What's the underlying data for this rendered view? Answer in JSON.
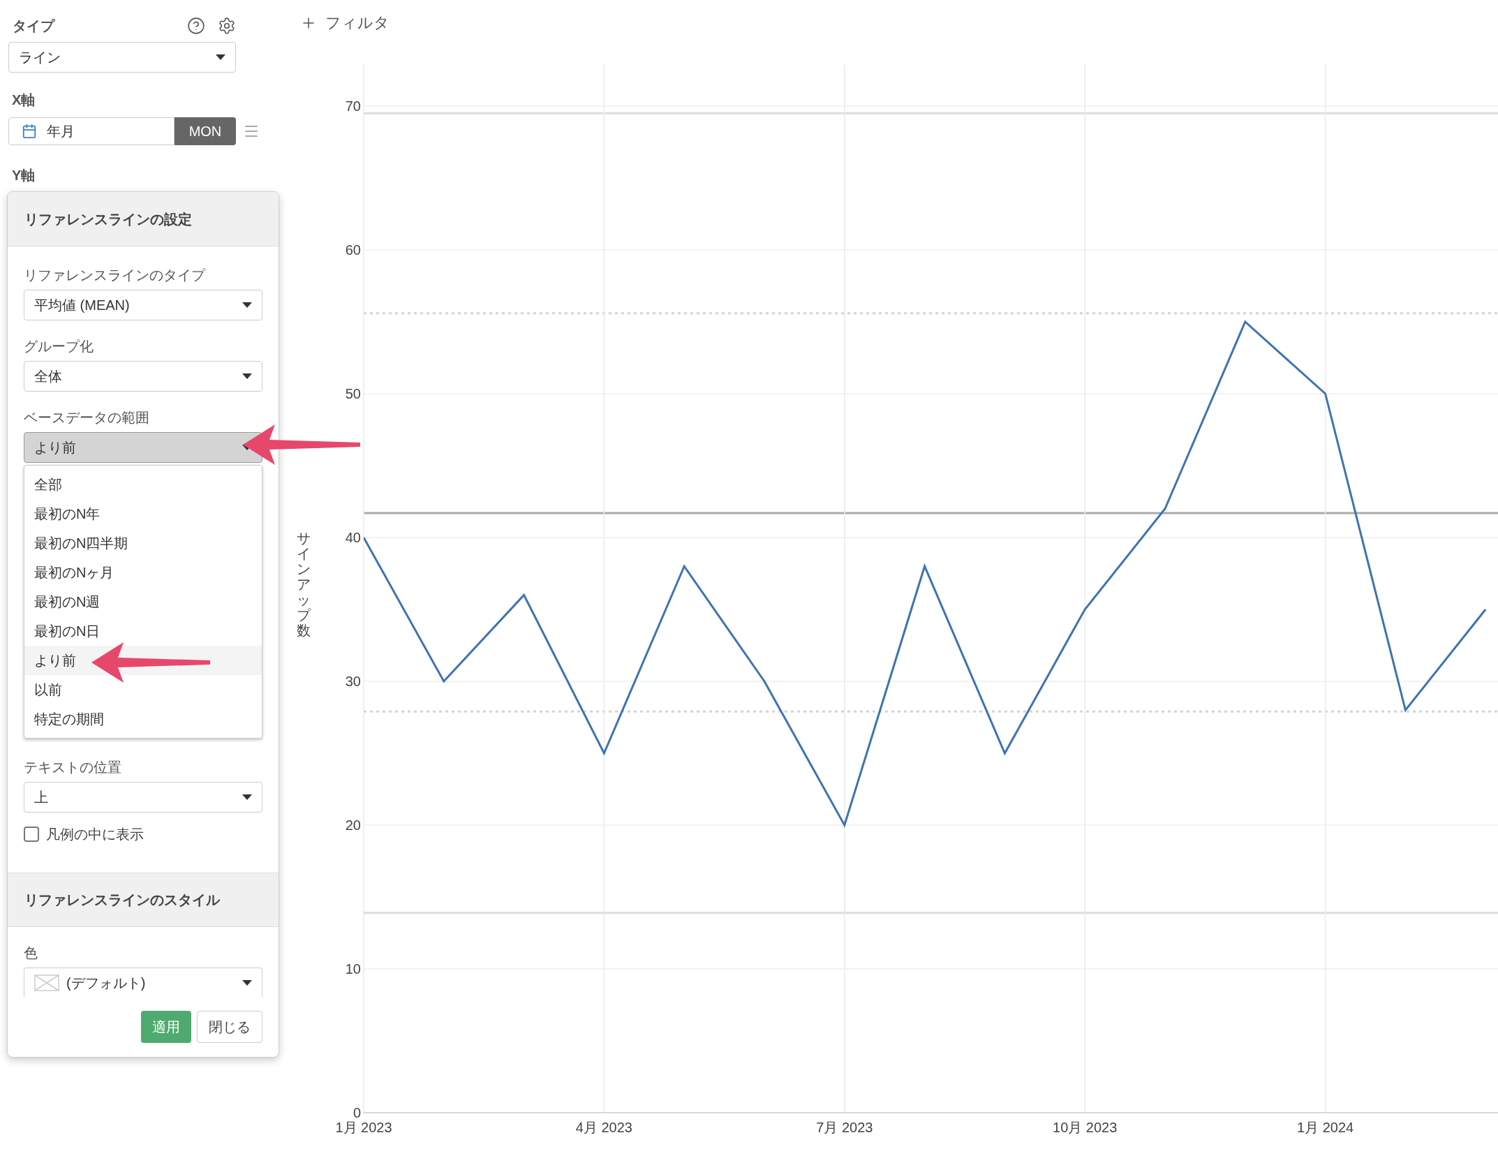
{
  "sidebar": {
    "type_label": "タイプ",
    "type_select": "ライン",
    "x_axis_label": "X軸",
    "x_field": {
      "label": "年月",
      "aggregation": "MON"
    },
    "y_axis_label": "Y軸"
  },
  "filter_button": "フィルタ",
  "reference_panel": {
    "title": "リファレンスラインの設定",
    "fields": [
      {
        "label": "リファレンスラインのタイプ",
        "value": "平均値 (MEAN)"
      },
      {
        "label": "グループ化",
        "value": "全体"
      }
    ],
    "range": {
      "label": "ベースデータの範囲",
      "value": "より前",
      "open": true,
      "options": [
        {
          "label": "全部",
          "selected": false
        },
        {
          "label": "最初のN年",
          "selected": false
        },
        {
          "label": "最初のN四半期",
          "selected": false
        },
        {
          "label": "最初のNヶ月",
          "selected": false
        },
        {
          "label": "最初のN週",
          "selected": false
        },
        {
          "label": "最初のN日",
          "selected": false
        },
        {
          "label": "より前",
          "selected": true
        },
        {
          "label": "以前",
          "selected": false
        },
        {
          "label": "特定の期間",
          "selected": false
        }
      ]
    },
    "text_position": {
      "label": "テキストの位置",
      "value": "上"
    },
    "legend_checkbox": {
      "label": "凡例の中に表示",
      "checked": false
    },
    "style_title": "リファレンスラインのスタイル",
    "color": {
      "label": "色",
      "value": "(デフォルト)"
    },
    "buttons": [
      {
        "label": "適用",
        "kind": "primary"
      },
      {
        "label": "閉じる",
        "kind": "default"
      }
    ]
  },
  "chart": {
    "chart_data": {
      "type": "line",
      "ylabel": "サインアップ数",
      "categories": [
        "1月 2023",
        null,
        null,
        "4月 2023",
        null,
        null,
        "7月 2023",
        null,
        null,
        "10月 2023",
        null,
        null,
        "1月 2024",
        null,
        null
      ],
      "series": [
        {
          "color": "#3d73b3",
          "values": [
            40,
            30,
            36,
            25,
            38,
            30,
            20,
            38,
            25,
            35,
            42,
            55,
            50,
            28,
            35
          ]
        }
      ],
      "ylim": [
        0,
        70
      ],
      "yticks": [
        0,
        10,
        20,
        30,
        40,
        50,
        60,
        70
      ],
      "grid": true
    }
  }
}
